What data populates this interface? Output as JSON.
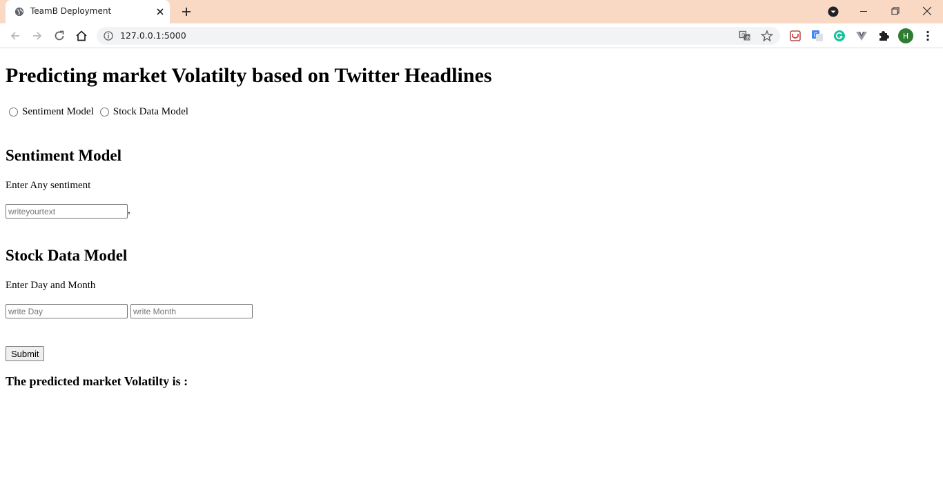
{
  "browser": {
    "tab": {
      "title": "TeamB Deployment",
      "favicon": "globe-icon",
      "close_icon": "close-icon"
    },
    "new_tab_icon": "plus-icon",
    "window_controls": [
      "minimize-icon",
      "restore-icon",
      "close-icon"
    ],
    "toolbar": {
      "back_icon": "back-arrow-icon",
      "forward_icon": "forward-arrow-icon",
      "reload_icon": "reload-icon",
      "home_icon": "home-icon",
      "url": "127.0.0.1:5000",
      "extensions": [
        "pocket-icon",
        "google-translate-icon",
        "grammarly-icon",
        "vuetify-icon",
        "puzzle-icon"
      ],
      "profile_initial": "H",
      "menu_icon": "kebab-menu-icon"
    },
    "colors": {
      "tabstrip": "#fad9c4",
      "avatar": "#2e7d32"
    }
  },
  "page": {
    "title": "Predicting market Volatilty based on Twitter Headlines",
    "radios": [
      {
        "label": "Sentiment Model",
        "checked": false
      },
      {
        "label": "Stock Data Model",
        "checked": false
      }
    ],
    "sentiment": {
      "heading": "Sentiment Model",
      "prompt": "Enter Any sentiment",
      "input_placeholder": "writeyourtext",
      "input_value": "",
      "trailing": ","
    },
    "stock": {
      "heading": "Stock Data Model",
      "prompt": "Enter Day and Month",
      "day_placeholder": "write Day",
      "month_placeholder": "write Month"
    },
    "submit_label": "Submit",
    "result_text": "The predicted market Volatilty is :"
  }
}
